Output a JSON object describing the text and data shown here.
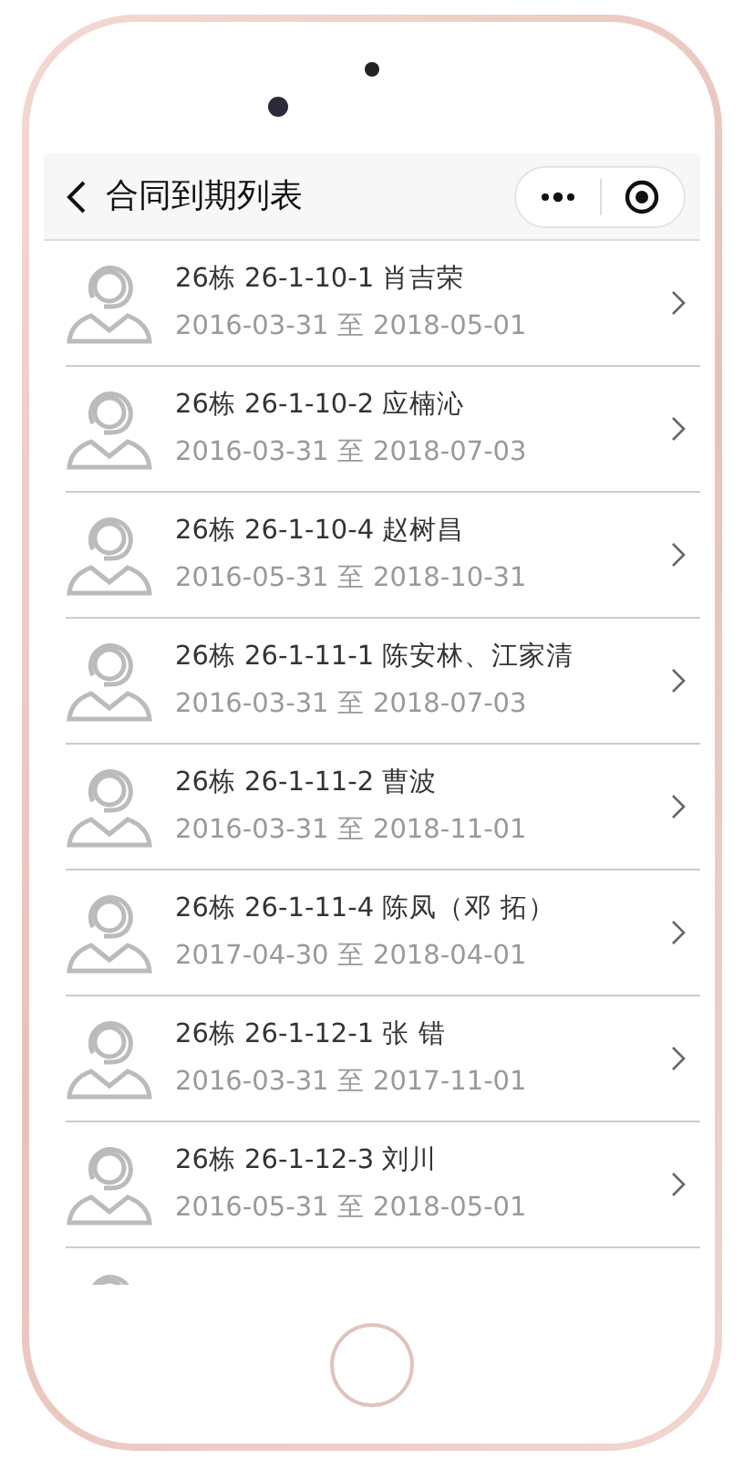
{
  "nav": {
    "title": "合同到期列表"
  },
  "items": [
    {
      "kind": "contract",
      "title": "26栋 26-1-10-1 肖吉荣",
      "dates": "2016-03-31 至 2018-05-01"
    },
    {
      "kind": "contract",
      "title": "26栋 26-1-10-2 应楠沁",
      "dates": "2016-03-31 至 2018-07-03"
    },
    {
      "kind": "contract",
      "title": "26栋 26-1-10-4 赵树昌",
      "dates": "2016-05-31 至 2018-10-31"
    },
    {
      "kind": "contract",
      "title": "26栋 26-1-11-1 陈安林、江家清",
      "dates": "2016-03-31 至 2018-07-03"
    },
    {
      "kind": "contract",
      "title": "26栋 26-1-11-2 曹波",
      "dates": "2016-03-31 至 2018-11-01"
    },
    {
      "kind": "contract",
      "title": "26栋 26-1-11-4 陈凤（邓 拓）",
      "dates": "2017-04-30 至 2018-04-01"
    },
    {
      "kind": "contract",
      "title": "26栋 26-1-12-1 张 错",
      "dates": "2016-03-31 至 2017-11-01"
    },
    {
      "kind": "contract",
      "title": "26栋 26-1-12-3 刘川",
      "dates": "2016-05-31 至 2018-05-01"
    },
    {
      "kind": "cut"
    }
  ]
}
